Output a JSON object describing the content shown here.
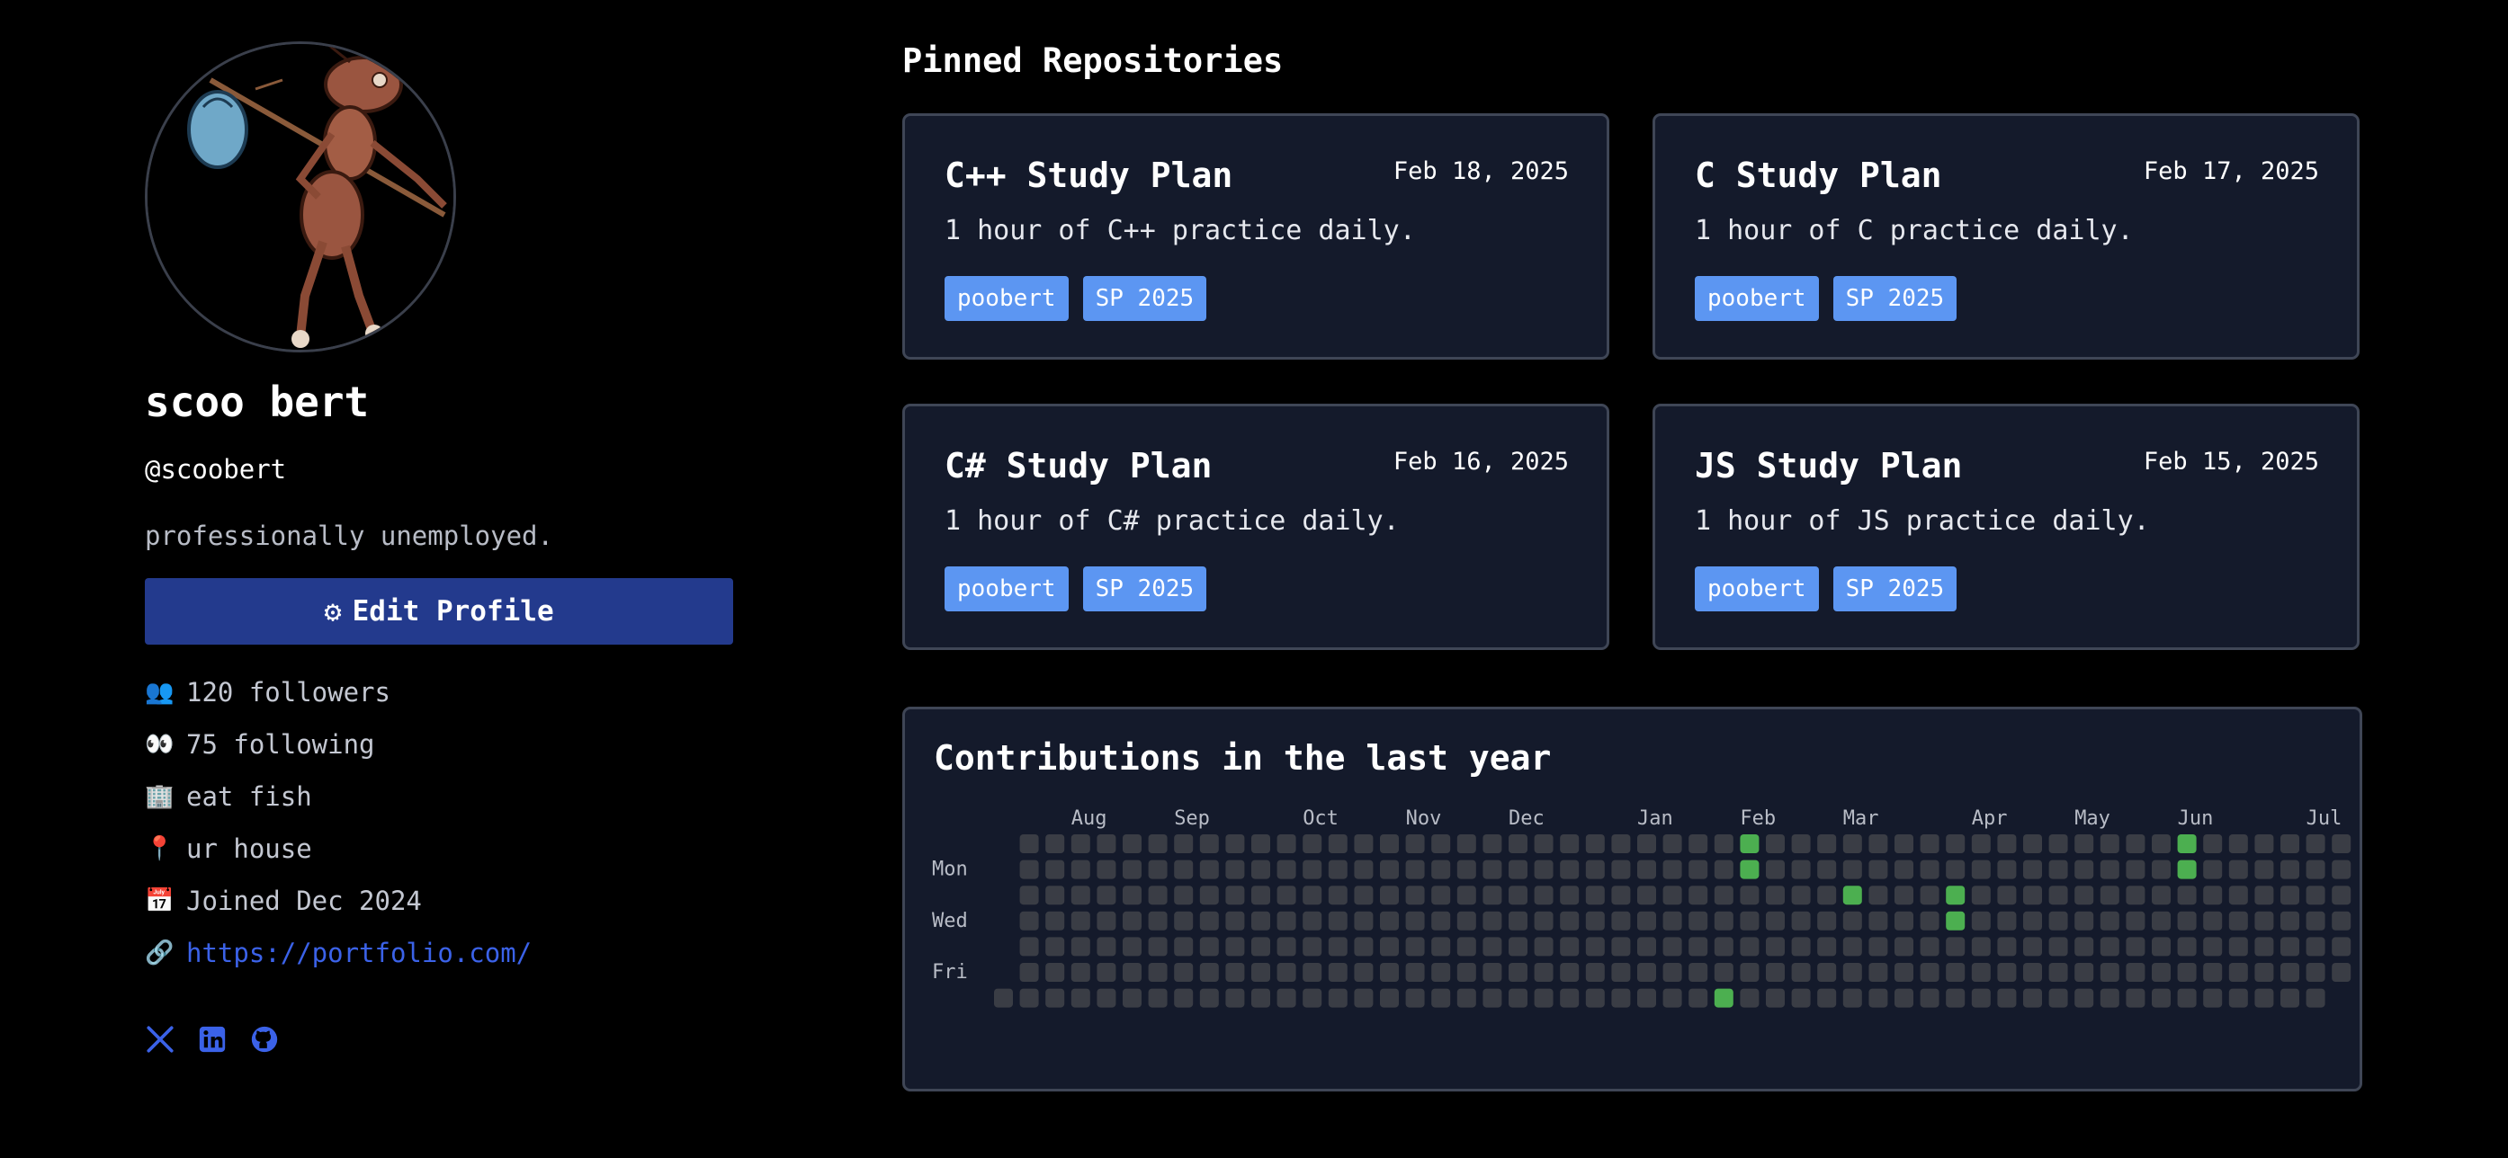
{
  "profile": {
    "display_name": "scoo bert",
    "username": "@scoobert",
    "bio": "professionally unemployed.",
    "edit_button_label": "Edit Profile",
    "followers": "120 followers",
    "following": "75 following",
    "company": "eat fish",
    "location": "ur house",
    "joined": "Joined Dec 2024",
    "website": "https://portfolio.com/",
    "icons": {
      "followers": "people-icon",
      "following": "eyes-icon",
      "company": "building-icon",
      "location": "pin-icon",
      "joined": "calendar-icon",
      "website": "link-icon"
    },
    "socials": [
      "x-icon",
      "linkedin-icon",
      "github-icon"
    ]
  },
  "pinned": {
    "title": "Pinned Repositories",
    "repos": [
      {
        "title": "C++ Study Plan",
        "date": "Feb 18, 2025",
        "description": "1 hour of C++ practice daily.",
        "tags": [
          "poobert",
          "SP 2025"
        ]
      },
      {
        "title": "C Study Plan",
        "date": "Feb 17, 2025",
        "description": "1 hour of C practice daily.",
        "tags": [
          "poobert",
          "SP 2025"
        ]
      },
      {
        "title": "C# Study Plan",
        "date": "Feb 16, 2025",
        "description": "1 hour of C# practice daily.",
        "tags": [
          "poobert",
          "SP 2025"
        ]
      },
      {
        "title": "JS Study Plan",
        "date": "Feb 15, 2025",
        "description": "1 hour of JS practice daily.",
        "tags": [
          "poobert",
          "SP 2025"
        ]
      }
    ]
  },
  "contributions": {
    "title": "Contributions in the last year",
    "months": [
      {
        "label": "Aug",
        "week": 3
      },
      {
        "label": "Sep",
        "week": 7
      },
      {
        "label": "Oct",
        "week": 12
      },
      {
        "label": "Nov",
        "week": 16
      },
      {
        "label": "Dec",
        "week": 20
      },
      {
        "label": "Jan",
        "week": 25
      },
      {
        "label": "Feb",
        "week": 29
      },
      {
        "label": "Mar",
        "week": 33
      },
      {
        "label": "Apr",
        "week": 38
      },
      {
        "label": "May",
        "week": 42
      },
      {
        "label": "Jun",
        "week": 46
      },
      {
        "label": "Jul",
        "week": 51
      }
    ],
    "day_labels": [
      {
        "label": "Mon",
        "day": 1
      },
      {
        "label": "Wed",
        "day": 3
      },
      {
        "label": "Fri",
        "day": 5
      }
    ],
    "weeks": 53,
    "first_week_start_day": 6,
    "last_week_end_day": 5,
    "active_cells": [
      {
        "week": 29,
        "day": 0
      },
      {
        "week": 29,
        "day": 1
      },
      {
        "week": 28,
        "day": 6
      },
      {
        "week": 33,
        "day": 2
      },
      {
        "week": 37,
        "day": 2
      },
      {
        "week": 37,
        "day": 3
      },
      {
        "week": 46,
        "day": 0
      },
      {
        "week": 46,
        "day": 1
      }
    ],
    "colors": {
      "empty": "#3a3d45",
      "active": "#4caf50"
    }
  },
  "theme": {
    "background": "#000000",
    "card": "#141a2b",
    "accent_button": "#233a8d",
    "tag": "#5c96f2",
    "link": "#3b62e8"
  }
}
